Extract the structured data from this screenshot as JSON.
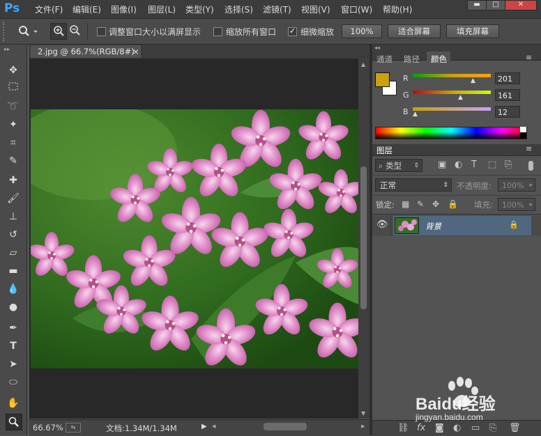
{
  "app": {
    "logo": "Ps",
    "menu": [
      "文件(F)",
      "编辑(E)",
      "图像(I)",
      "图层(L)",
      "类型(Y)",
      "选择(S)",
      "滤镜(T)",
      "视图(V)",
      "窗口(W)",
      "帮助(H)"
    ]
  },
  "options": {
    "zoom_tool_icon": "zoom-icon",
    "fit_window_label": "调整窗口大小以满屏显示",
    "zoom_all_label": "缩放所有窗口",
    "scrubby_label": "细微缩放",
    "scrubby_checked": true,
    "btn_100": "100%",
    "btn_fit": "适合屏幕",
    "btn_fill": "填充屏幕"
  },
  "document": {
    "tab_title": "2.jpg @ 66.7%(RGB/8#)",
    "close_glyph": "×",
    "zoom": "66.67%",
    "doc_size": "文档:1.34M/1.34M"
  },
  "color_panel": {
    "tabs": [
      "通道",
      "路径",
      "颜色"
    ],
    "active_tab": "颜色",
    "foreground": "#c9a10c",
    "r_label": "R",
    "g_label": "G",
    "b_label": "B",
    "r": "201",
    "g": "161",
    "b": "12"
  },
  "layers_panel": {
    "title": "图层",
    "filter_kind": "类型",
    "blend_mode": "正常",
    "opacity_label": "不透明度:",
    "opacity_value": "100%",
    "lock_label": "锁定:",
    "fill_label": "填充:",
    "fill_value": "100%",
    "layers": [
      {
        "name": "背景",
        "visible": true,
        "locked": true
      }
    ]
  },
  "watermark": {
    "brand": "Baidu经验",
    "url": "jingyan.baidu.com"
  }
}
